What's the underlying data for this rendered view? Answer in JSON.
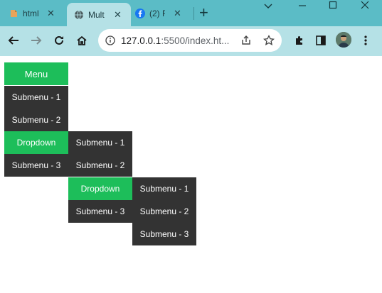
{
  "browser": {
    "tabs": [
      {
        "title": "html"
      },
      {
        "title": "Mult"
      },
      {
        "title": "(2) F"
      }
    ],
    "url_host": "127.0.0.1",
    "url_rest": ":5500/index.ht..."
  },
  "menu": {
    "header": "Menu",
    "level1": [
      "Submenu - 1",
      "Submenu - 2",
      "Dropdown",
      "Submenu - 3"
    ],
    "level2": [
      "Submenu - 1",
      "Submenu - 2",
      "Dropdown",
      "Submenu - 3"
    ],
    "level3": [
      "Submenu - 1",
      "Submenu - 2",
      "Submenu - 3"
    ]
  },
  "colors": {
    "accent": "#1dbe5a",
    "menu_dark": "#333333",
    "tabstrip": "#5bbcc6",
    "toolbar": "#b5e1e6"
  },
  "icons": [
    "html-file-icon",
    "globe-icon",
    "facebook-icon",
    "back-arrow-icon",
    "forward-arrow-icon",
    "reload-icon",
    "home-icon",
    "site-info-icon",
    "share-icon",
    "bookmark-star-icon",
    "extensions-puzzle-icon",
    "side-panel-icon",
    "kebab-menu-icon"
  ]
}
